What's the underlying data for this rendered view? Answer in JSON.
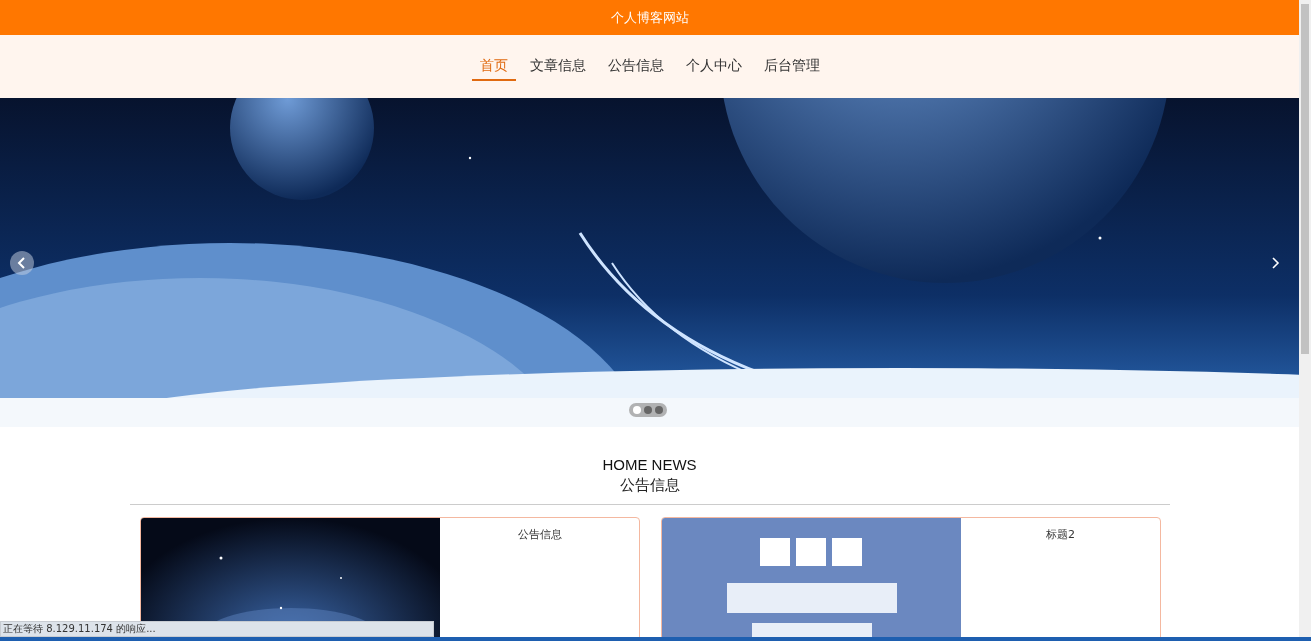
{
  "site_title": "个人博客网站",
  "nav": [
    {
      "label": "首页",
      "selected": true
    },
    {
      "label": "文章信息",
      "selected": false
    },
    {
      "label": "公告信息",
      "selected": false
    },
    {
      "label": "个人中心",
      "selected": false
    },
    {
      "label": "后台管理",
      "selected": false
    }
  ],
  "carousel": {
    "dots": [
      {
        "selected": true
      },
      {
        "selected": false
      },
      {
        "selected": false
      }
    ]
  },
  "section": {
    "title_en": "HOME NEWS",
    "title": "公告信息"
  },
  "cards": [
    {
      "title": "公告信息"
    },
    {
      "title": "标题2"
    }
  ],
  "status_bar": {
    "text": "正在等待 8.129.11.174 的响应..."
  }
}
